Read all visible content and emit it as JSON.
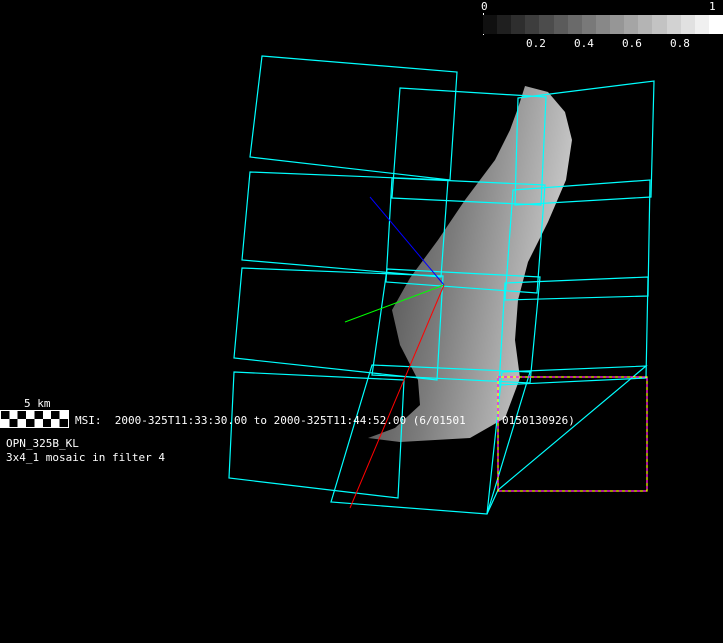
{
  "colorbar": {
    "min_label": "0",
    "max_label": "1",
    "tick_labels": [
      "0.2",
      "0.4",
      "0.6",
      "0.8"
    ],
    "steps": 17
  },
  "scale_bar": {
    "label": "5 km"
  },
  "info": {
    "msi_line": "MSI:  2000-325T11:33:30.00 to 2000-325T11:44:52.00 (6/01501",
    "msi_line_end": "0150130926)",
    "target_id": "OPN_325B_KL",
    "mosaic_desc": "3x4_1 mosaic in filter 4"
  },
  "colors": {
    "footprint": "#00ffff",
    "axis_x": "#ff0000",
    "axis_y": "#00ff00",
    "axis_z": "#0000ff",
    "highlight_frame": "#ff00ff",
    "highlight_dash": "#ffff00"
  }
}
